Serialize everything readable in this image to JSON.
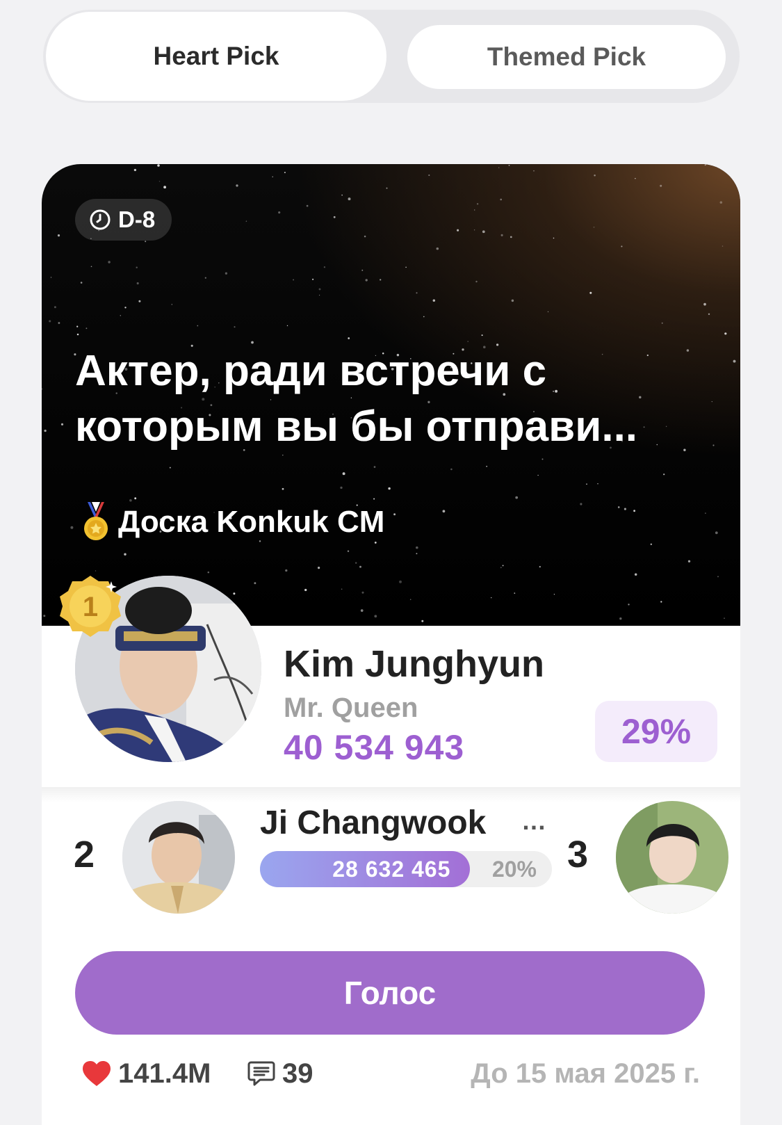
{
  "tabs": [
    {
      "label": "Heart Pick",
      "active": true
    },
    {
      "label": "Themed Pick",
      "active": false
    }
  ],
  "poll": {
    "dday": "D-8",
    "title": "Актер, ради встречи с которым вы бы отправи...",
    "board": "Доска Konkuk CM"
  },
  "leader": {
    "rank": "1",
    "name": "Kim Junghyun",
    "work": "Mr. Queen",
    "votes": "40 534 943",
    "percent": "29%"
  },
  "runner": {
    "rank": "2",
    "name": "Ji Changwook",
    "more": "…",
    "votes": "28 632 465",
    "percent": "20%",
    "fill_fraction": 0.72
  },
  "third": {
    "rank": "3"
  },
  "vote_button": "Голос",
  "footer": {
    "hearts": "141.4M",
    "comments": "39",
    "deadline": "До 15 мая 2025 г."
  },
  "colors": {
    "accent": "#9d5fd1",
    "button": "#a06ccb",
    "heart": "#e8383b"
  }
}
